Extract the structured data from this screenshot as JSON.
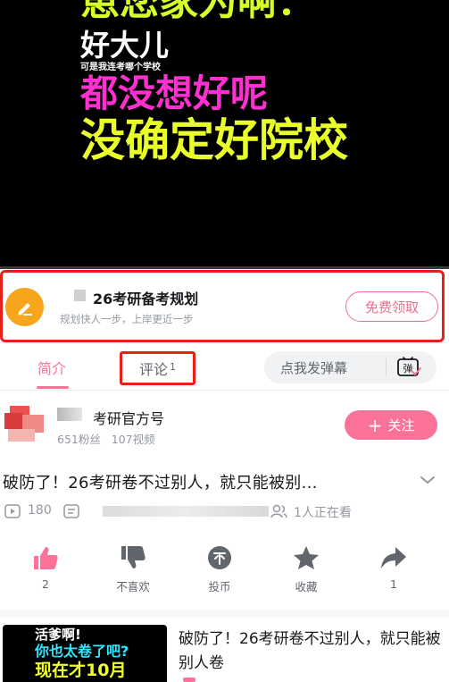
{
  "video": {
    "caption_line1": "崽您家为啊：",
    "caption_line2": "好大儿",
    "caption_line3": "可是我连考哪个学校",
    "caption_line4": "都没想好呢",
    "caption_line5": "没确定好院校"
  },
  "promo": {
    "title": "26考研备考规划",
    "subtitle": "规划快人一步，上岸更近一步",
    "button": "免费领取",
    "icon": "pencil-icon"
  },
  "tabs": {
    "intro": "简介",
    "comment": "评论",
    "comment_count": "1",
    "danmaku_placeholder": "点我发弹幕",
    "danmaku_icon": "弹"
  },
  "uploader": {
    "name": "考研官方号",
    "fans": "651粉丝",
    "videos": "107视频",
    "follow_label": "关注"
  },
  "video_info": {
    "title": "破防了！26考研卷不过别人，就只能被别...",
    "plays": "180",
    "viewers": "1人正在看"
  },
  "actions": [
    {
      "label": "2",
      "icon": "like-icon"
    },
    {
      "label": "不喜欢",
      "icon": "dislike-icon"
    },
    {
      "label": "投币",
      "icon": "coin-icon"
    },
    {
      "label": "收藏",
      "icon": "star-icon"
    },
    {
      "label": "1",
      "icon": "share-icon"
    }
  ],
  "related": {
    "thumb_line1": "活爹啊!",
    "thumb_line2": "你也太卷了吧?",
    "thumb_line3": "现在才10月",
    "title": "破防了！26考研卷不过别人，就只能被别人卷"
  },
  "colors": {
    "accent": "#fb7299",
    "highlight_box": "#e8201a",
    "promo_icon": "#f7a51c"
  }
}
